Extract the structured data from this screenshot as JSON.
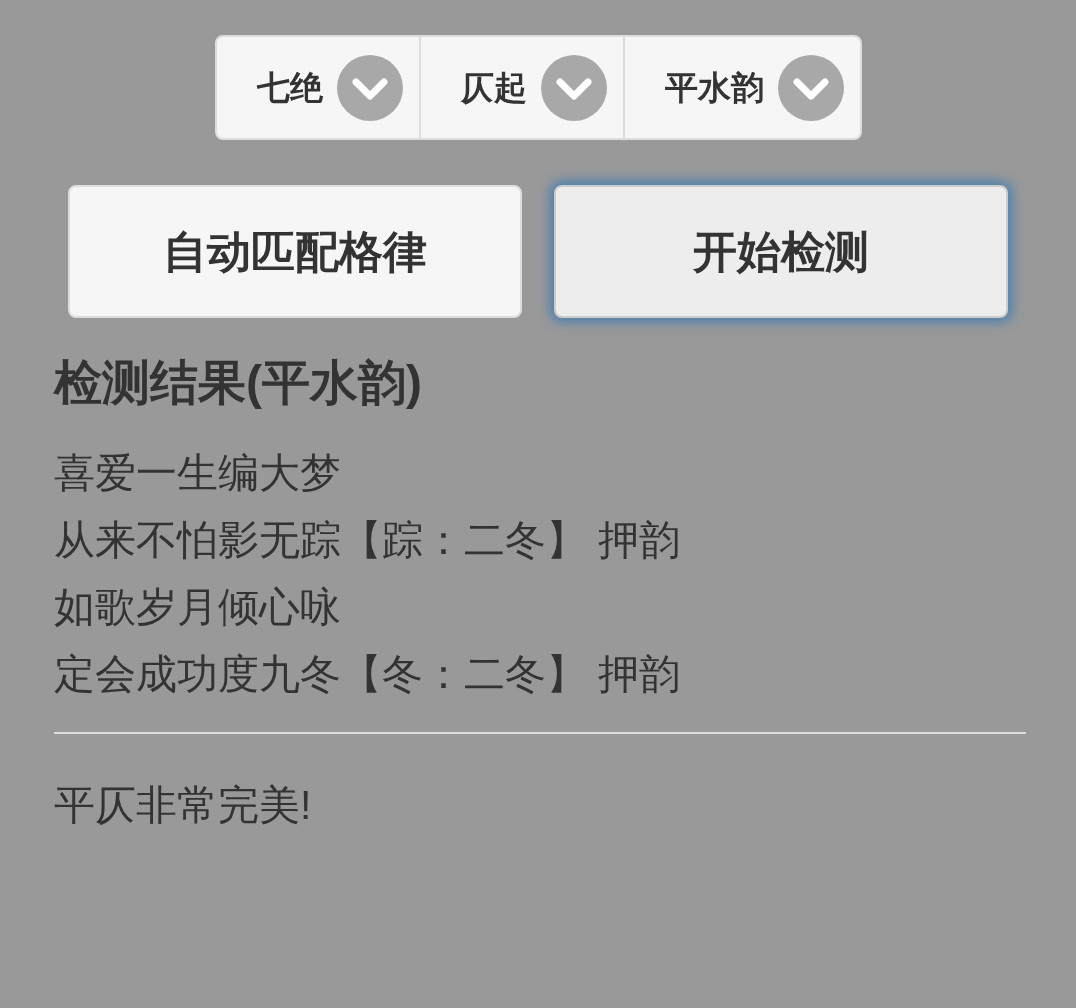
{
  "selectors": [
    {
      "label": "七绝"
    },
    {
      "label": "仄起"
    },
    {
      "label": "平水韵"
    }
  ],
  "buttons": [
    {
      "label": "自动匹配格律",
      "focused": false
    },
    {
      "label": "开始检测",
      "focused": true
    }
  ],
  "result": {
    "heading": "检测结果(平水韵)",
    "lines": [
      "喜爱一生编大梦",
      "从来不怕影无踪【踪：二冬】 押韵",
      "如歌岁月倾心咏",
      "定会成功度九冬【冬：二冬】 押韵"
    ],
    "summary": "平仄非常完美!"
  }
}
